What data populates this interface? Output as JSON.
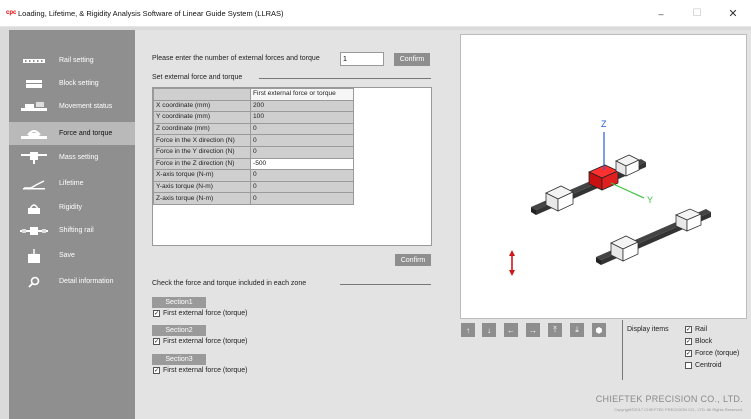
{
  "window": {
    "logo": "cpc",
    "title": "Loading, Lifetime, & Rigidity Analysis Software of Linear Guide System (LLRAS)",
    "minimize": "–",
    "maximize": "☐",
    "close": "✕"
  },
  "sidebar": {
    "items": [
      {
        "label": "Rail setting",
        "icon": "rail-icon"
      },
      {
        "label": "Block setting",
        "icon": "block-icon"
      },
      {
        "label": "Movement status",
        "icon": "movement-icon"
      },
      {
        "label": "Force and torque",
        "icon": "force-icon"
      },
      {
        "label": "Mass setting",
        "icon": "mass-icon"
      },
      {
        "label": "Lifetime",
        "icon": "lifetime-icon"
      },
      {
        "label": "Rigidity",
        "icon": "rigidity-icon"
      },
      {
        "label": "Shifting rail",
        "icon": "shifting-rail-icon"
      },
      {
        "label": "Save",
        "icon": "save-icon"
      },
      {
        "label": "Detail information",
        "icon": "search-icon"
      }
    ],
    "active_index": 3
  },
  "force": {
    "prompt": "Please enter the number of external forces and torque",
    "count_value": "1",
    "confirm_label": "Confirm",
    "set_header": "Set external force and torque",
    "column_header": "First external force or torque",
    "rows": [
      {
        "label": "X coordinate (mm)",
        "value": "200"
      },
      {
        "label": "Y coordinate (mm)",
        "value": "100"
      },
      {
        "label": "Z coordinate (mm)",
        "value": "0"
      },
      {
        "label": "Force in the X direction (N)",
        "value": "0"
      },
      {
        "label": "Force in the Y direction (N)",
        "value": "0"
      },
      {
        "label": "Force in the Z direction (N)",
        "value": "-500"
      },
      {
        "label": "X-axis torque (N-m)",
        "value": "0"
      },
      {
        "label": "Y-axis torque (N-m)",
        "value": "0"
      },
      {
        "label": "Z-axis torque (N-m)",
        "value": "0"
      }
    ],
    "selected_row": 5,
    "table_confirm_label": "Confirm",
    "zone_header": "Check the force and torque included in each zone",
    "sections": [
      {
        "label": "Section1",
        "check_label": "First external force (torque)",
        "checked": true
      },
      {
        "label": "Section2",
        "check_label": "First external force (torque)",
        "checked": true
      },
      {
        "label": "Section3",
        "check_label": "First external force (torque)",
        "checked": true
      }
    ]
  },
  "viewer": {
    "axis_z": "Z",
    "axis_y": "Y",
    "nav_buttons": [
      {
        "glyph": "↑",
        "icon": "arrow-up-icon"
      },
      {
        "glyph": "↓",
        "icon": "arrow-down-icon"
      },
      {
        "glyph": "←",
        "icon": "arrow-left-icon"
      },
      {
        "glyph": "→",
        "icon": "arrow-right-icon"
      },
      {
        "glyph": "⤒",
        "icon": "move-top-icon"
      },
      {
        "glyph": "⤓",
        "icon": "move-bottom-icon"
      },
      {
        "glyph": "⬢",
        "icon": "iso-view-icon"
      }
    ],
    "display_label": "Display items",
    "display_items": [
      {
        "label": "Rail",
        "checked": true
      },
      {
        "label": "Block",
        "checked": true
      },
      {
        "label": "Force (torque)",
        "checked": true
      },
      {
        "label": "Centroid",
        "checked": false
      }
    ],
    "company": "CHIEFTEK PRECISION CO., LTD.",
    "copyright": "Copyright©2017 CHIEFTEK PRECISION CO., LTD. All Rights Reserved."
  },
  "colors": {
    "sidebar_bg": "#8f8f8f",
    "sidebar_active": "#b9b9b9",
    "block_red": "#e02020",
    "axis_z": "#2a5bd7",
    "axis_y": "#3cc03c",
    "force_arrow": "#d01818"
  }
}
